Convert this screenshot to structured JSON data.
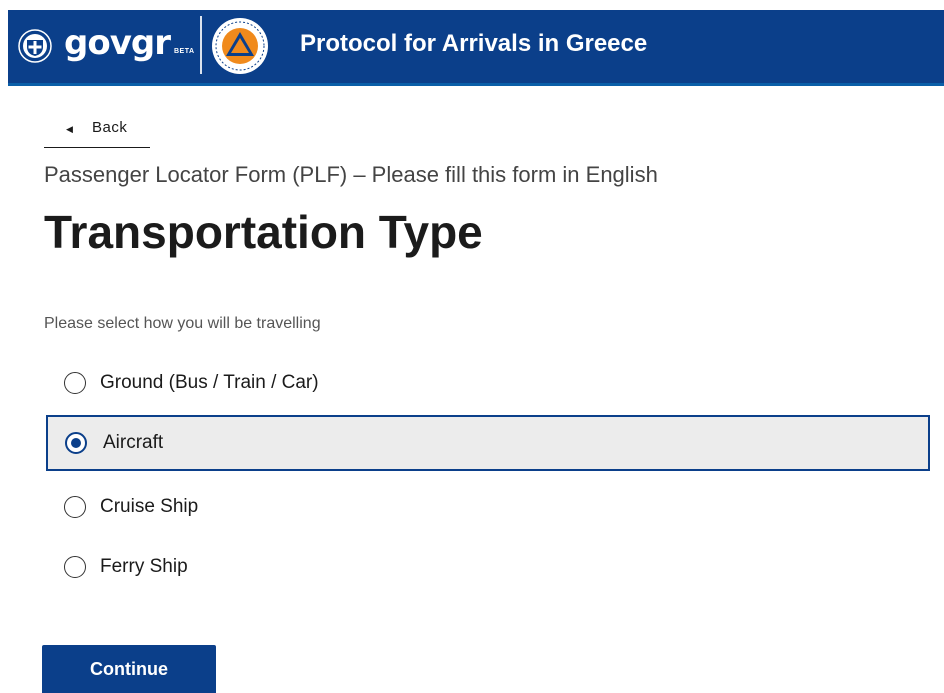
{
  "header": {
    "logo_prefix": "gov",
    "logo_suffix": "gr",
    "logo_badge": "BETA",
    "title": "Protocol for Arrivals in Greece"
  },
  "nav": {
    "back_label": "Back"
  },
  "form": {
    "subtitle": "Passenger Locator Form (PLF) – Please fill this form in English",
    "title": "Transportation Type",
    "prompt": "Please select how you will be travelling",
    "options": [
      {
        "label": "Ground (Bus / Train / Car)",
        "selected": false
      },
      {
        "label": "Aircraft",
        "selected": true
      },
      {
        "label": "Cruise Ship",
        "selected": false
      },
      {
        "label": "Ferry Ship",
        "selected": false
      }
    ],
    "continue_label": "Continue"
  },
  "colors": {
    "header_bg": "#0b3f8a",
    "accent": "#0b3f8a",
    "selected_bg": "#ececec",
    "text_dark": "#1b1b1b"
  },
  "icons": {
    "emblem": "greek-coat-of-arms-icon",
    "civil_protection": "civil-protection-logo-icon",
    "back": "caret-left-icon"
  }
}
